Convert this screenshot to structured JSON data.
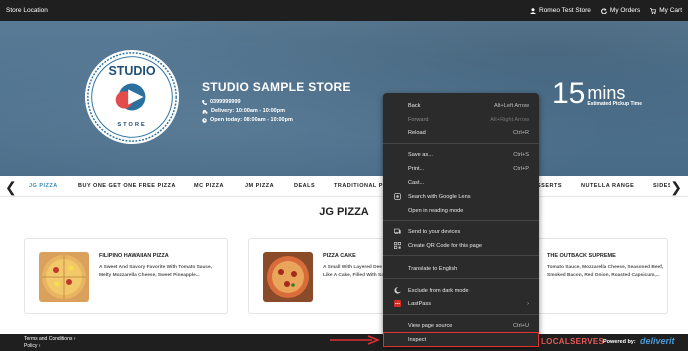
{
  "topbar": {
    "store_location": "Store Location",
    "user": "Romeo Test Store",
    "orders": "My Orders",
    "cart": "My Cart"
  },
  "hero": {
    "logo_text_top": "STUDIO",
    "logo_text_bottom": "STORE",
    "store_name": "STUDIO SAMPLE STORE",
    "phone": "0399999999",
    "delivery": "Delivery: 10:00am - 10:00pm",
    "open_today": "Open today: 08:00am - 10:00pm",
    "pickup_number": "15",
    "pickup_unit": "mins",
    "pickup_label": "Estimated Pickup Time"
  },
  "categories": [
    "JG PIZZA",
    "BUY ONE GET ONE FREE PIZZA",
    "MC PIZZA",
    "JM PIZZA",
    "DEALS",
    "TRADITIONAL P",
    "SSERTS",
    "NUTELLA RANGE",
    "SIDES"
  ],
  "section": {
    "title": "JG PIZZA"
  },
  "products": [
    {
      "title": "FILIPINO HAWAIIAN PIZZA",
      "line1": "A Sweet And Savory Favorite With Tomato Sauce,",
      "line2": "Melty Mozzarella Cheese, Sweet Pineapple..."
    },
    {
      "title": "PIZZA CAKE",
      "line1": "A Small With Layered Dee",
      "line2": "Like A Cake, Filled With Sa"
    },
    {
      "title": "THE OUTBACK SUPREME",
      "line1": "Tomato Sauce, Mozzarella Cheese, Seasoned Beef,",
      "line2": "Smoked Bacon, Red Onion, Roasted Capsicum,..."
    }
  ],
  "footer": {
    "terms": "Terms and Conditions ›",
    "policy": "Policy ›",
    "brand": "LOCALSERVES",
    "powered": "Powered by:",
    "deliverit": "deliverit"
  },
  "context_menu": {
    "back": {
      "label": "Back",
      "shortcut": "Alt+Left Arrow"
    },
    "forward": {
      "label": "Forward",
      "shortcut": "Alt+Right Arrow"
    },
    "reload": {
      "label": "Reload",
      "shortcut": "Ctrl+R"
    },
    "save_as": {
      "label": "Save as...",
      "shortcut": "Ctrl+S"
    },
    "print": {
      "label": "Print...",
      "shortcut": "Ctrl+P"
    },
    "cast": {
      "label": "Cast..."
    },
    "google_lens": {
      "label": "Search with Google Lens"
    },
    "reading_mode": {
      "label": "Open in reading mode"
    },
    "send_devices": {
      "label": "Send to your devices"
    },
    "qr_code": {
      "label": "Create QR Code for this page"
    },
    "translate": {
      "label": "Translate to English"
    },
    "dark_mode": {
      "label": "Exclude from dark mode"
    },
    "lastpass": {
      "label": "LastPass"
    },
    "view_source": {
      "label": "View page source",
      "shortcut": "Ctrl+U"
    },
    "inspect": {
      "label": "Inspect"
    }
  },
  "colors": {
    "topbar_bg": "#1f1f1f",
    "accent": "#3a8bbd",
    "menu_bg": "#2b2b2b",
    "highlight": "#e03030"
  }
}
